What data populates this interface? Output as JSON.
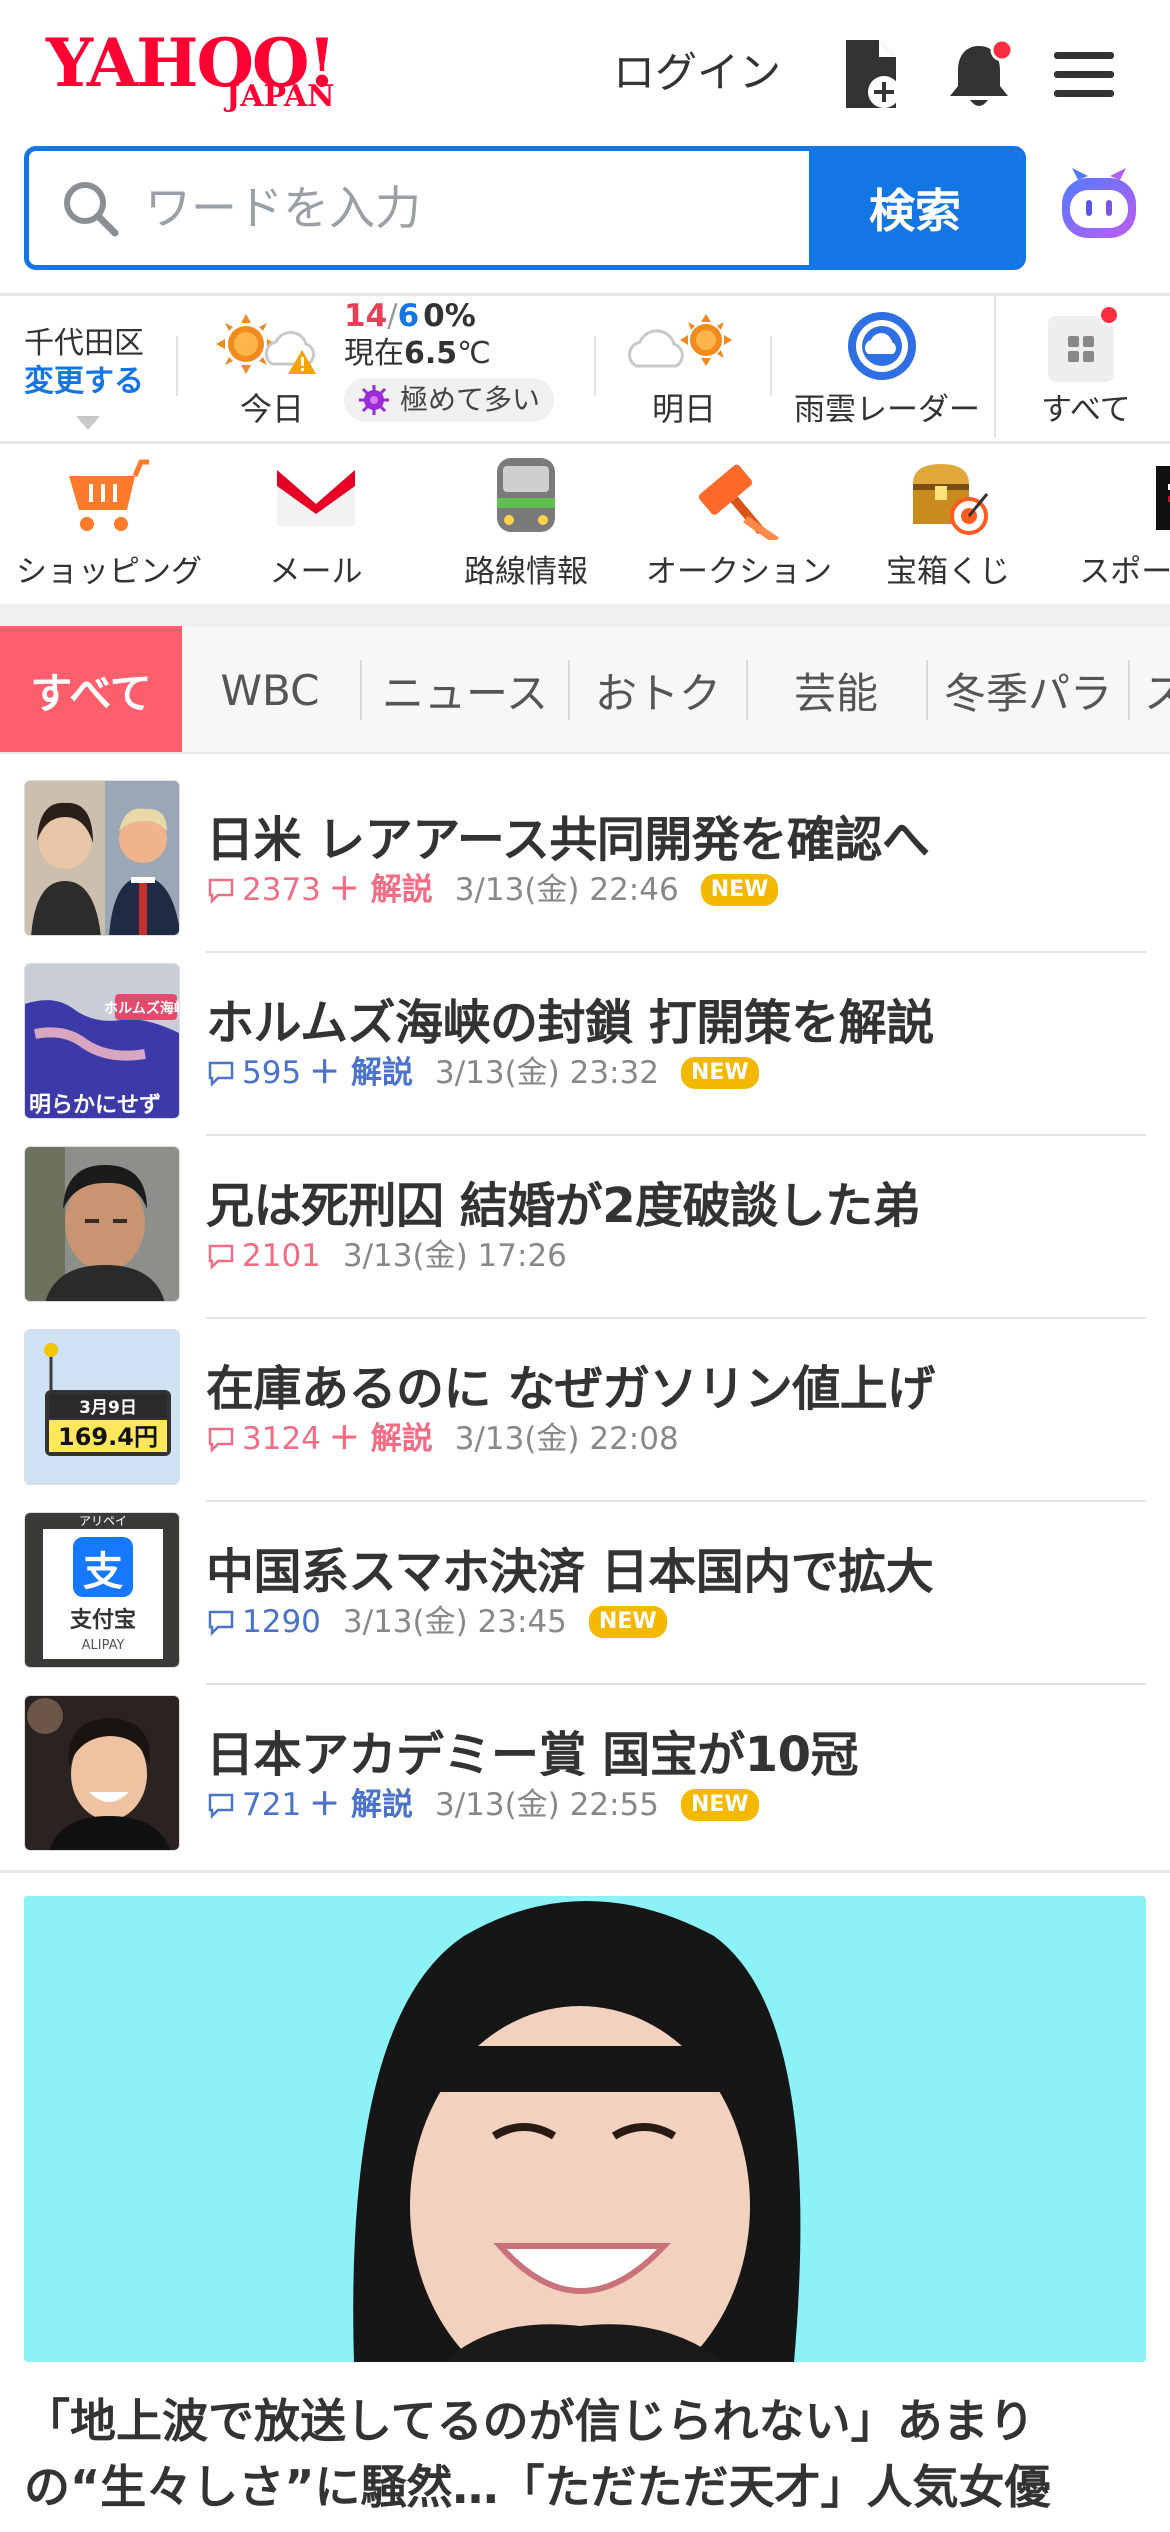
{
  "header": {
    "logo_main": "YAHOO!",
    "logo_sub": "JAPAN",
    "login_label": "ログイン"
  },
  "search": {
    "placeholder": "ワードを入力",
    "button_label": "検索"
  },
  "weather": {
    "area": "千代田区",
    "change_label": "変更する",
    "today_label": "今日",
    "high": "14",
    "low": "6",
    "precip": "0%",
    "now_prefix": "現在",
    "now_temp": "6.5",
    "now_unit": "℃",
    "pollen": "極めて多い",
    "tomorrow_label": "明日",
    "radar_label": "雨雲レーダー",
    "all_label": "すべて"
  },
  "services": [
    {
      "label": "ショッピング",
      "icon": "cart-icon"
    },
    {
      "label": "メール",
      "icon": "mail-icon"
    },
    {
      "label": "路線情報",
      "icon": "train-icon"
    },
    {
      "label": "オークション",
      "icon": "gavel-icon"
    },
    {
      "label": "宝箱くじ",
      "icon": "treasure-icon"
    },
    {
      "label": "スポーツ",
      "icon": "sports-icon"
    }
  ],
  "tabs": [
    "すべて",
    "WBC",
    "ニュース",
    "おトク",
    "芸能",
    "冬季パラ",
    "スポーツ"
  ],
  "news": [
    {
      "title": "日米 レアアース共同開発を確認へ",
      "count": "2373",
      "kaisetsu": "＋ 解説",
      "date": "3/13(金) 22:46",
      "new": "NEW",
      "tone": "pink"
    },
    {
      "title": "ホルムズ海峡の封鎖 打開策を解説",
      "count": "595",
      "kaisetsu": "＋ 解説",
      "date": "3/13(金) 23:32",
      "new": "NEW",
      "tone": "blue"
    },
    {
      "title": "兄は死刑囚 結婚が2度破談した弟",
      "count": "2101",
      "kaisetsu": "",
      "date": "3/13(金) 17:26",
      "new": "",
      "tone": "pink"
    },
    {
      "title": "在庫あるのに なぜガソリン値上げ",
      "count": "3124",
      "kaisetsu": "＋ 解説",
      "date": "3/13(金) 22:08",
      "new": "",
      "tone": "pink"
    },
    {
      "title": "中国系スマホ決済 日本国内で拡大",
      "count": "1290",
      "kaisetsu": "",
      "date": "3/13(金) 23:45",
      "new": "NEW",
      "tone": "blue"
    },
    {
      "title": "日本アカデミー賞 国宝が10冠",
      "count": "721",
      "kaisetsu": "＋ 解説",
      "date": "3/13(金) 22:55",
      "new": "NEW",
      "tone": "blue"
    }
  ],
  "thumb_text": {
    "map_label": "ホルムズ海峡",
    "map_caption": "明らかにせず",
    "price_date": "3月9日",
    "price": "169.4円",
    "alipay_top": "アリペイ",
    "alipay_cn": "支付宝",
    "alipay_en": "ALIPAY"
  },
  "feature": {
    "headline": "「地上波で放送してるのが信じられない」あまりの“生々しさ”に騒然…「ただただ天才」人気女優"
  },
  "colors": {
    "brand_red": "#ff0033",
    "search_blue": "#1475e5",
    "tab_active": "#ff5f6d",
    "new_badge": "#f5b800"
  }
}
